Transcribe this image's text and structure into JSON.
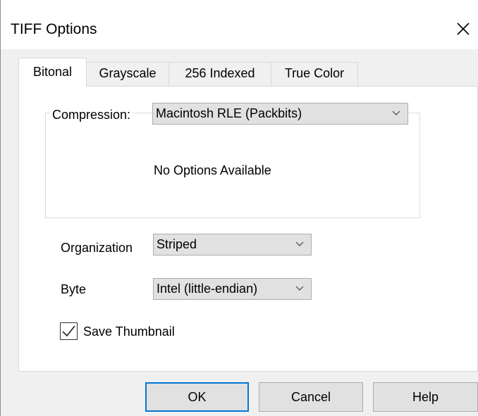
{
  "window": {
    "title": "TIFF Options"
  },
  "tabs": [
    {
      "label": "Bitonal",
      "active": true
    },
    {
      "label": "Grayscale",
      "active": false
    },
    {
      "label": "256 Indexed",
      "active": false
    },
    {
      "label": "True Color",
      "active": false
    }
  ],
  "compression": {
    "label": "Compression:",
    "selected": "Macintosh RLE (Packbits)",
    "options_message": "No Options Available"
  },
  "organization": {
    "label": "Organization",
    "selected": "Striped"
  },
  "byte": {
    "label": "Byte",
    "selected": "Intel (little-endian)"
  },
  "save_thumbnail": {
    "label": "Save Thumbnail",
    "checked": true
  },
  "buttons": {
    "ok": "OK",
    "cancel": "Cancel",
    "help": "Help"
  },
  "colors": {
    "default_button_border": "#0078d7",
    "control_face": "#e1e1e1"
  },
  "icons": {
    "close": "close-icon",
    "dropdown": "chevron-down-icon",
    "check": "checkmark-icon"
  }
}
